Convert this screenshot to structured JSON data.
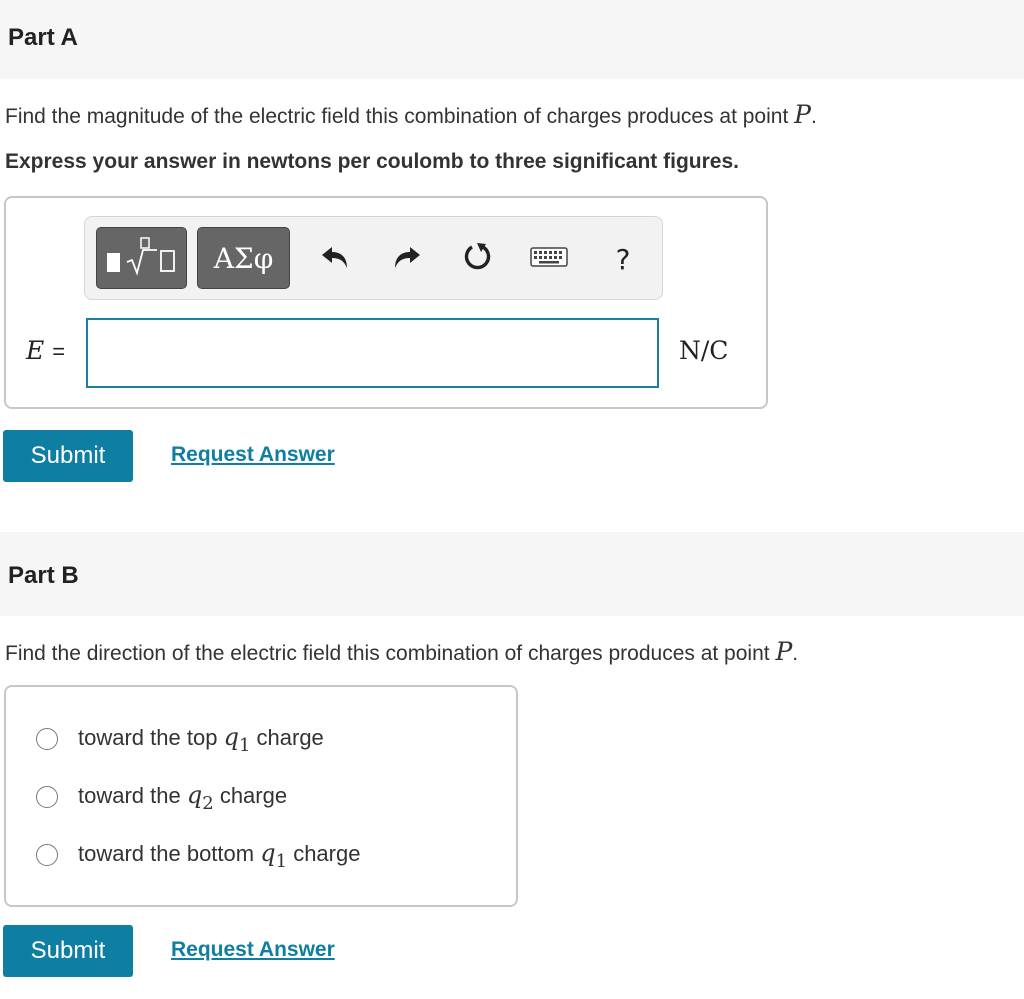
{
  "part_a": {
    "title": "Part A",
    "prompt_text": "Find the magnitude of the electric field this combination of charges produces at point",
    "point_var": "P",
    "period": ".",
    "instruction": "Express your answer in newtons per coulomb to three significant figures.",
    "toolbar": {
      "templates_icon": "fraction-sqrt-templates-icon",
      "symbols_label": "ΑΣφ",
      "undo_icon": "undo-icon",
      "redo_icon": "redo-icon",
      "reset_icon": "reset-icon",
      "keyboard_icon": "keyboard-icon",
      "help_label": "?"
    },
    "variable": "E",
    "equals": "=",
    "answer_value": "",
    "unit": "N/C",
    "submit_label": "Submit",
    "request_answer_label": "Request Answer"
  },
  "part_b": {
    "title": "Part B",
    "prompt_text": "Find the direction of the electric field this combination of charges produces at point",
    "point_var": "P",
    "period": ".",
    "choices": [
      {
        "prefix": "toward the top",
        "var": "q",
        "sub": "1",
        "suffix": "charge"
      },
      {
        "prefix": "toward the",
        "var": "q",
        "sub": "2",
        "suffix": "charge"
      },
      {
        "prefix": "toward the bottom",
        "var": "q",
        "sub": "1",
        "suffix": "charge"
      }
    ],
    "submit_label": "Submit",
    "request_answer_label": "Request Answer"
  },
  "colors": {
    "accent": "#0f7ea3",
    "header_bg": "#f6f6f6",
    "toolbar_button": "#666666"
  }
}
